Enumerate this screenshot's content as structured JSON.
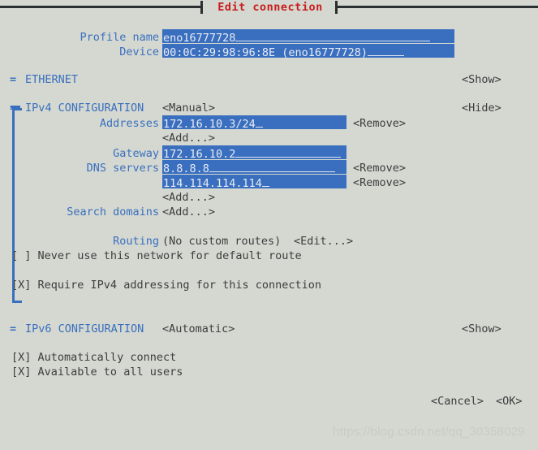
{
  "window": {
    "title": "Edit connection",
    "title_color": "#c81d1d",
    "background_color": "#d4d8d0",
    "accent_color": "#3a6fbf",
    "text_color": "#3a3f3f"
  },
  "header_fields": [
    {
      "label": "Profile name",
      "value": "eno16777728",
      "name": "profile-name"
    },
    {
      "label": "Device",
      "value": "00:0C:29:98:96:8E (eno16777728)",
      "name": "device"
    }
  ],
  "ethernet_section": {
    "marker": "=",
    "title": "ETHERNET",
    "toggle_label": "<Show>"
  },
  "ipv4_section": {
    "marker": "=",
    "title": "IPv4 CONFIGURATION",
    "mode": "<Manual>",
    "toggle_label": "<Hide>",
    "addresses": {
      "label": "Addresses",
      "entries": [
        {
          "value": "172.16.10.3/24",
          "remove_label": "<Remove>"
        }
      ],
      "add_label": "<Add...>"
    },
    "gateway": {
      "label": "Gateway",
      "value": "172.16.10.2"
    },
    "dns_servers": {
      "label": "DNS servers",
      "entries": [
        {
          "value": "8.8.8.8",
          "remove_label": "<Remove>"
        },
        {
          "value": "114.114.114.114",
          "remove_label": "<Remove>"
        }
      ],
      "add_label": "<Add...>"
    },
    "search_domains": {
      "label": "Search domains",
      "add_label": "<Add...>"
    },
    "routing": {
      "label": "Routing",
      "status": "(No custom routes)",
      "edit_label": "<Edit...>"
    },
    "never_default_route": {
      "checkbox": "[ ]",
      "label": "Never use this network for default route",
      "checked": false
    },
    "require_ipv4": {
      "checkbox": "[X]",
      "label": "Require IPv4 addressing for this connection",
      "checked": true
    }
  },
  "ipv6_section": {
    "marker": "=",
    "title": "IPv6 CONFIGURATION",
    "mode": "<Automatic>",
    "toggle_label": "<Show>"
  },
  "global_options": [
    {
      "checkbox": "[X]",
      "label": "Automatically connect",
      "checked": true,
      "name": "automatically-connect"
    },
    {
      "checkbox": "[X]",
      "label": "Available to all users",
      "checked": true,
      "name": "available-to-all-users"
    }
  ],
  "footer": {
    "cancel_label": "<Cancel>",
    "ok_label": "<OK>"
  },
  "watermark": {
    "text": "https://blog.csdn.net/qq_30358029"
  }
}
